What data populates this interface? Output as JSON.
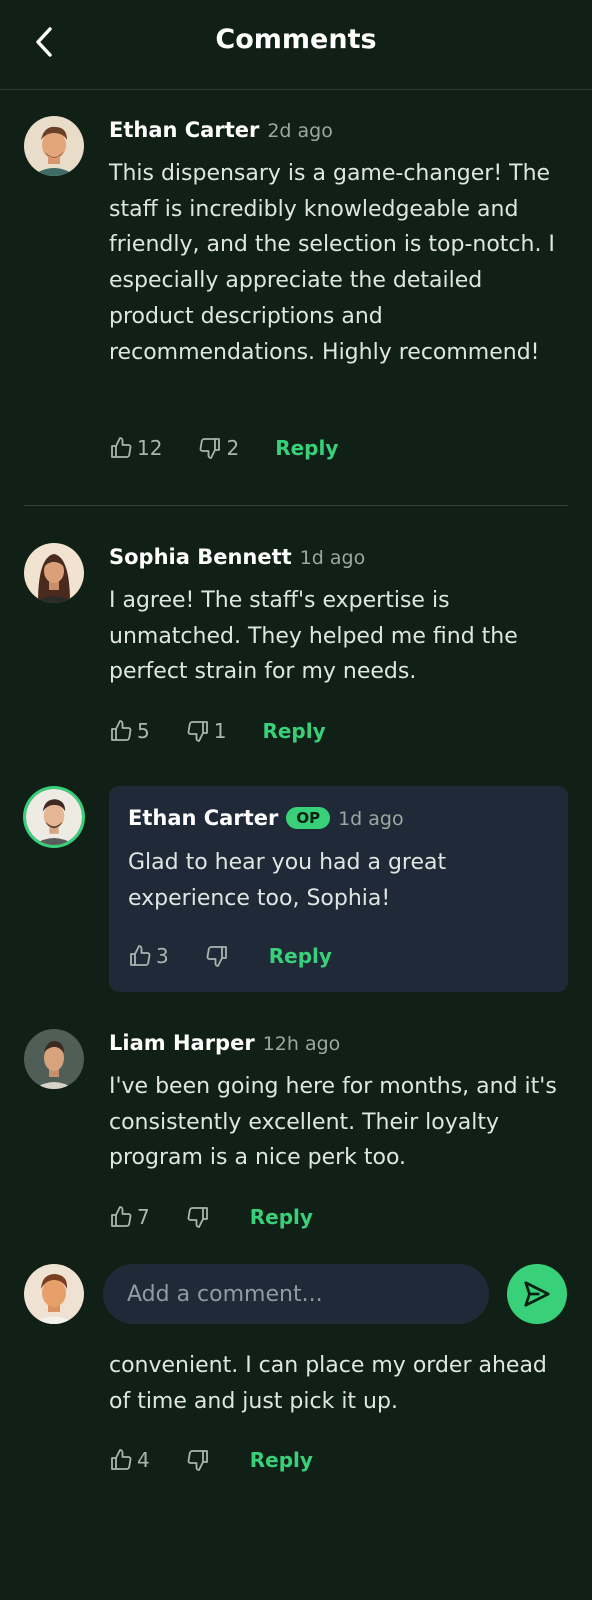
{
  "header": {
    "title": "Comments"
  },
  "comments": [
    {
      "author": "Ethan Carter",
      "time": "2d ago",
      "text": "This dispensary is a game-changer! The staff is incredibly knowledgeable and friendly, and the selection is top-notch. I especially appreciate the detailed product descriptions and recommendations. Highly recommend!",
      "likes": "12",
      "dislikes": "2",
      "reply_label": "Reply"
    },
    {
      "author": "Sophia Bennett",
      "time": "1d ago",
      "text": "I agree! The staff's expertise is unmatched. They helped me find the perfect strain for my needs.",
      "likes": "5",
      "dislikes": "1",
      "reply_label": "Reply"
    },
    {
      "author": "Ethan Carter",
      "badge": "OP",
      "time": "1d ago",
      "text": "Glad to hear you had a great experience too, Sophia!",
      "likes": "3",
      "dislikes": "",
      "reply_label": "Reply"
    },
    {
      "author": "Liam Harper",
      "time": "12h ago",
      "text": "I've been going here for months, and it's consistently excellent. Their loyalty program is a nice perk too.",
      "likes": "7",
      "dislikes": "",
      "reply_label": "Reply"
    },
    {
      "text": "convenient. I can place my order ahead of time and just pick it up.",
      "likes": "4",
      "dislikes": "",
      "reply_label": "Reply"
    }
  ],
  "composer": {
    "placeholder": "Add a comment..."
  },
  "colors": {
    "background": "#102016",
    "accent": "#39d07a",
    "card": "#1f2937"
  },
  "icons": {
    "back": "chevron-left-icon",
    "like": "thumbs-up-icon",
    "dislike": "thumbs-down-icon",
    "send": "send-icon"
  }
}
